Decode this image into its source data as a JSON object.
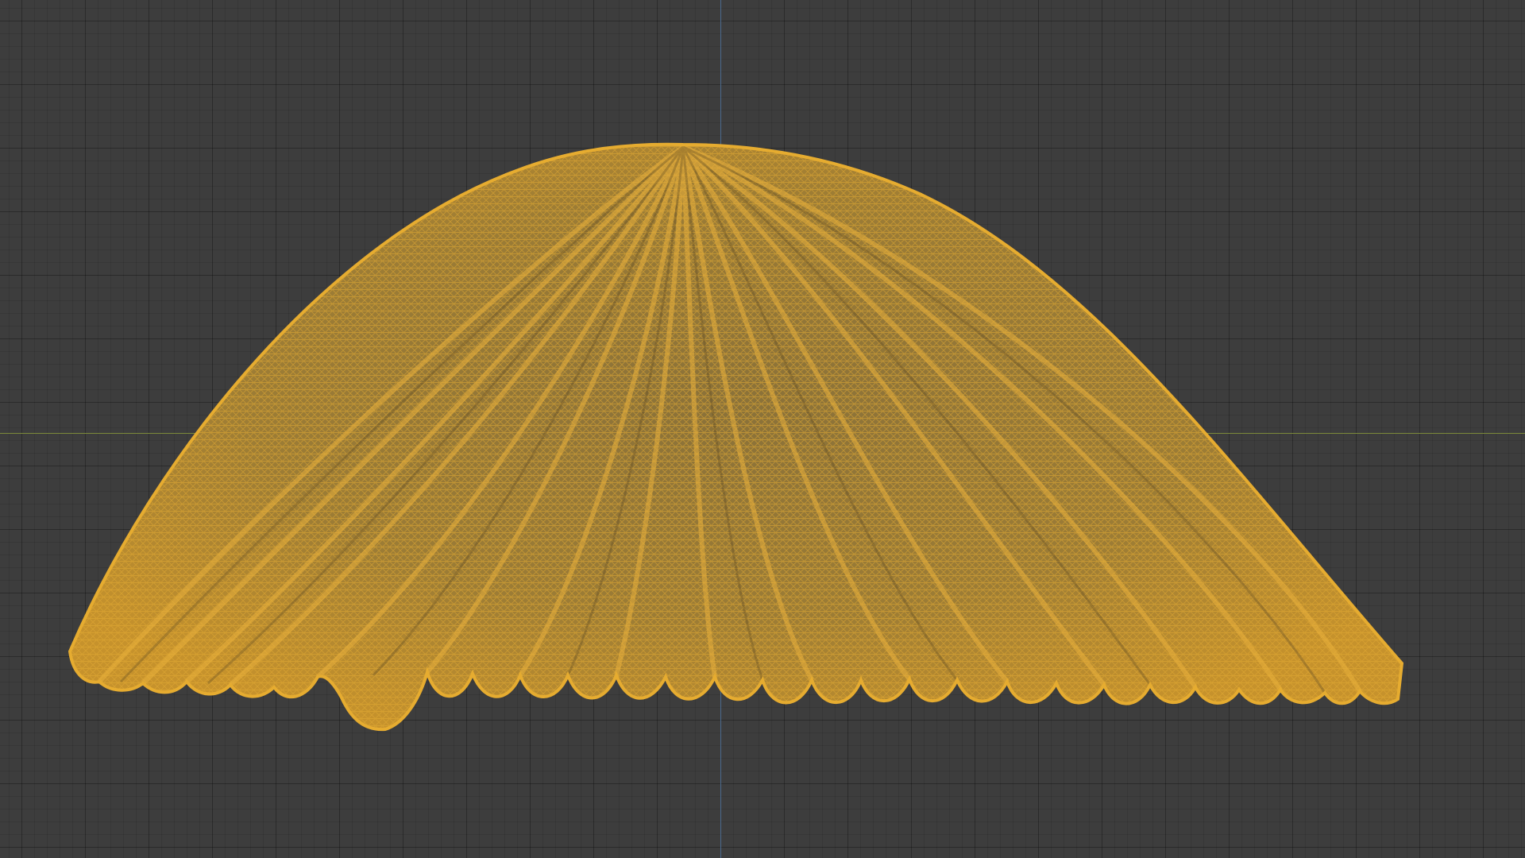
{
  "viewport": {
    "mode": "wireframe",
    "background_color": "#3d3d3d",
    "grid_color": "#2e2e2e",
    "x_axis_color": "#7c8a3a",
    "y_axis_color": "#4a6a8e"
  },
  "object": {
    "shape": "scalloped dome mesh",
    "wire_color": "#e0a52a",
    "fill_color": "#9a7a34"
  }
}
